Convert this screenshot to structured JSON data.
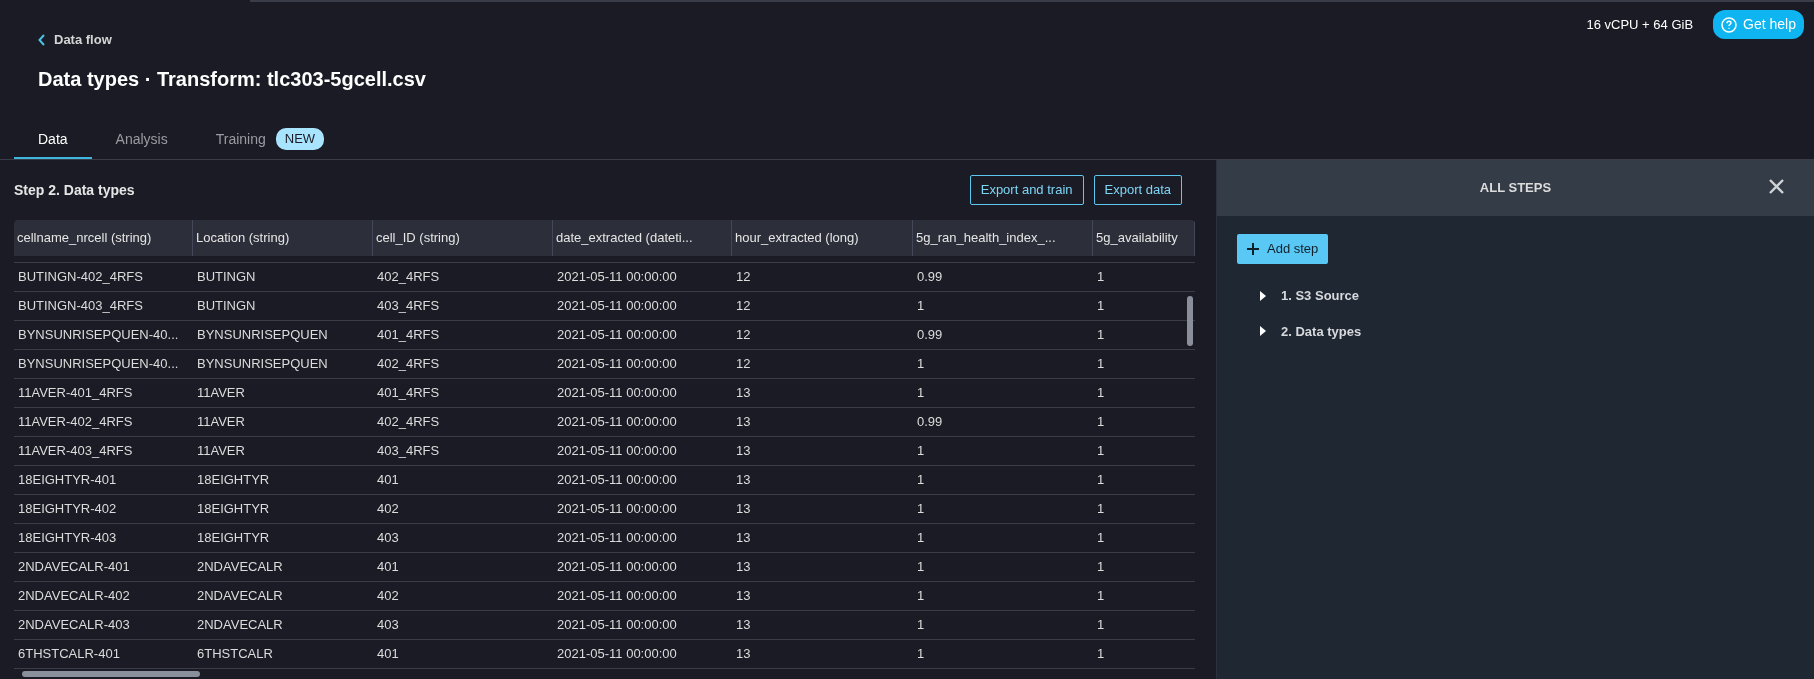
{
  "top_bar": {
    "instance": "16 vCPU + 64 GiB",
    "help_button": "Get help"
  },
  "breadcrumb": "Data flow",
  "title": "Data types · Transform: tlc303-5gcell.csv",
  "tabs": [
    {
      "label": "Data",
      "selected": true
    },
    {
      "label": "Analysis",
      "selected": false
    },
    {
      "label": "Training",
      "selected": false,
      "badge": "NEW"
    }
  ],
  "step_title": "Step 2. Data types",
  "buttons": [
    "Export and train",
    "Export data"
  ],
  "table": {
    "columns": [
      "cellname_nrcell (string)",
      "Location (string)",
      "cell_ID (string)",
      "date_extracted (dateti...",
      "hour_extracted (long)",
      "5g_ran_health_index_...",
      "5g_availability"
    ],
    "rows": [
      [
        "BUTINGN-402_4RFS",
        "BUTINGN",
        "402_4RFS",
        "2021-05-11 00:00:00",
        "12",
        "0.99",
        "1"
      ],
      [
        "BUTINGN-403_4RFS",
        "BUTINGN",
        "403_4RFS",
        "2021-05-11 00:00:00",
        "12",
        "1",
        "1"
      ],
      [
        "BYNSUNRISEPQUEN-40...",
        "BYNSUNRISEPQUEN",
        "401_4RFS",
        "2021-05-11 00:00:00",
        "12",
        "0.99",
        "1"
      ],
      [
        "BYNSUNRISEPQUEN-40...",
        "BYNSUNRISEPQUEN",
        "402_4RFS",
        "2021-05-11 00:00:00",
        "12",
        "1",
        "1"
      ],
      [
        "11AVER-401_4RFS",
        "11AVER",
        "401_4RFS",
        "2021-05-11 00:00:00",
        "13",
        "1",
        "1"
      ],
      [
        "11AVER-402_4RFS",
        "11AVER",
        "402_4RFS",
        "2021-05-11 00:00:00",
        "13",
        "0.99",
        "1"
      ],
      [
        "11AVER-403_4RFS",
        "11AVER",
        "403_4RFS",
        "2021-05-11 00:00:00",
        "13",
        "1",
        "1"
      ],
      [
        "18EIGHTYR-401",
        "18EIGHTYR",
        "401",
        "2021-05-11 00:00:00",
        "13",
        "1",
        "1"
      ],
      [
        "18EIGHTYR-402",
        "18EIGHTYR",
        "402",
        "2021-05-11 00:00:00",
        "13",
        "1",
        "1"
      ],
      [
        "18EIGHTYR-403",
        "18EIGHTYR",
        "403",
        "2021-05-11 00:00:00",
        "13",
        "1",
        "1"
      ],
      [
        "2NDAVECALR-401",
        "2NDAVECALR",
        "401",
        "2021-05-11 00:00:00",
        "13",
        "1",
        "1"
      ],
      [
        "2NDAVECALR-402",
        "2NDAVECALR",
        "402",
        "2021-05-11 00:00:00",
        "13",
        "1",
        "1"
      ],
      [
        "2NDAVECALR-403",
        "2NDAVECALR",
        "403",
        "2021-05-11 00:00:00",
        "13",
        "1",
        "1"
      ],
      [
        "6THSTCALR-401",
        "6THSTCALR",
        "401",
        "2021-05-11 00:00:00",
        "13",
        "1",
        "1"
      ]
    ]
  },
  "steps_panel": {
    "title": "ALL STEPS",
    "add_button": "Add step",
    "steps": [
      {
        "label": "1. S3 Source",
        "expanded": false
      },
      {
        "label": "2. Data types",
        "expanded": false
      }
    ]
  }
}
